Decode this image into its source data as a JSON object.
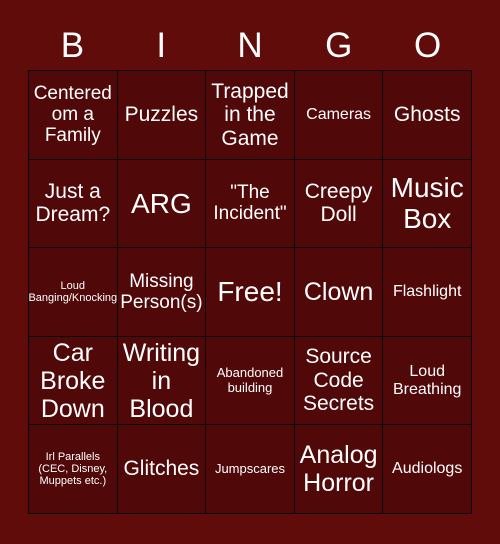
{
  "page": {
    "background_color": "#5f0c0b",
    "cell_color": "#500808",
    "border_color": "#0a0203",
    "text_color": "#ffffff",
    "title": "BINGO"
  },
  "header": {
    "letters": [
      "B",
      "I",
      "N",
      "G",
      "O"
    ]
  },
  "grid": {
    "columns": 5,
    "rows": 5,
    "cells": [
      {
        "text": "Centered om a Family",
        "size": "fs-md"
      },
      {
        "text": "Puzzles",
        "size": "fs-lg"
      },
      {
        "text": "Trapped in the Game",
        "size": "fs-lg"
      },
      {
        "text": "Cameras",
        "size": "fs-sm"
      },
      {
        "text": "Ghosts",
        "size": "fs-lg"
      },
      {
        "text": "Just a Dream?",
        "size": "fs-lg"
      },
      {
        "text": "ARG",
        "size": "fs-xxl"
      },
      {
        "text": "\"The Incident\"",
        "size": "fs-md"
      },
      {
        "text": "Creepy Doll",
        "size": "fs-lg"
      },
      {
        "text": "Music Box",
        "size": "fs-xxl"
      },
      {
        "text": "Loud Banging/Knocking",
        "size": "fs-xxs"
      },
      {
        "text": "Missing Person(s)",
        "size": "fs-md"
      },
      {
        "text": "Free!",
        "size": "fs-xxl"
      },
      {
        "text": "Clown",
        "size": "fs-xl"
      },
      {
        "text": "Flashlight",
        "size": "fs-sm"
      },
      {
        "text": "Car Broke Down",
        "size": "fs-xl"
      },
      {
        "text": "Writing in Blood",
        "size": "fs-xl"
      },
      {
        "text": "Abandoned building",
        "size": "fs-xs"
      },
      {
        "text": "Source Code Secrets",
        "size": "fs-lg"
      },
      {
        "text": "Loud Breathing",
        "size": "fs-sm"
      },
      {
        "text": "Irl Parallels (CEC, Disney, Muppets etc.)",
        "size": "fs-xxs"
      },
      {
        "text": "Glitches",
        "size": "fs-lg"
      },
      {
        "text": "Jumpscares",
        "size": "fs-xs"
      },
      {
        "text": "Analog Horror",
        "size": "fs-xl"
      },
      {
        "text": "Audiologs",
        "size": "fs-sm"
      }
    ]
  }
}
